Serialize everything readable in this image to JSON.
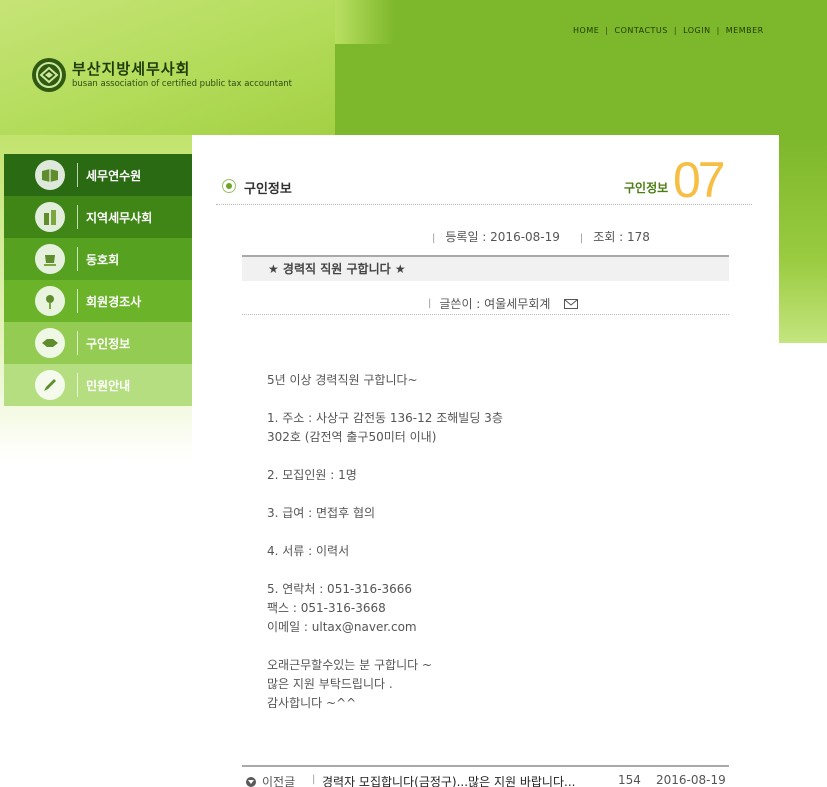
{
  "top_nav": [
    "HOME",
    "CONTACTUS",
    "LOGIN",
    "MEMBER"
  ],
  "logo": {
    "name_ko": "부산지방세무사회",
    "name_en": "busan association of certified public tax accountant"
  },
  "sidebar": {
    "items": [
      {
        "label": "세무연수원",
        "icon": "book-icon"
      },
      {
        "label": "지역세무사회",
        "icon": "buildings-icon"
      },
      {
        "label": "동호회",
        "icon": "cup-icon"
      },
      {
        "label": "회원경조사",
        "icon": "flower-icon"
      },
      {
        "label": "구인정보",
        "icon": "handshake-icon"
      },
      {
        "label": "민원안내",
        "icon": "pen-icon"
      }
    ]
  },
  "page": {
    "title": "구인정보",
    "breadcrumb": "구인정보",
    "section_number": "07"
  },
  "post": {
    "date_label": "등록일 : 2016-08-19",
    "views_label": "조회 : 178",
    "subject": "★ 경력직 직원 구합니다 ★",
    "writer_label": "글쓴이 : 여울세무회계",
    "body": "5년 이상 경력직원 구합니다~\n\n1. 주소 : 사상구 감전동 136-12 조해빌딩 3층\n302호 (감전역 출구50미터 이내)\n\n2. 모집인원 : 1명\n\n3. 급여 : 면접후 협의\n\n4. 서류 : 이력서\n\n5. 연락처 : 051-316-3666\n팩스 : 051-316-3668\n이메일 : ultax@naver.com\n\n오래근무할수있는 분 구합니다 ~\n많은 지원 부탁드립니다 .\n감사합니다 ~^^"
  },
  "prev_post": {
    "label": "이전글",
    "title": "경력자 모집합니다(금정구)...많은 지원 바랍니다...",
    "views": "154",
    "date": "2016-08-19"
  },
  "colors": {
    "header_green": "#7db72b",
    "accent_orange": "#f7be44",
    "breadcrumb_green": "#4b7e12"
  }
}
